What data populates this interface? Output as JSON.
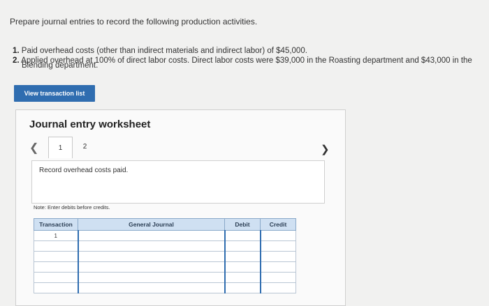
{
  "prompt": "Prepare journal entries to record the following production activities.",
  "requirements": [
    {
      "num": "1.",
      "text": "Paid overhead costs (other than indirect materials and indirect labor) of $45,000."
    },
    {
      "num": "2.",
      "text": "Applied overhead at 100% of direct labor costs. Direct labor costs were $39,000 in the Roasting department and $43,000 in the",
      "cont": "Blending department."
    }
  ],
  "view_button_label": "View transaction list",
  "worksheet": {
    "title": "Journal entry worksheet",
    "prev_icon": "chevron-left-icon",
    "next_icon": "chevron-right-icon",
    "tabs": [
      "1",
      "2"
    ],
    "active_tab": "1",
    "instruction": "Record overhead costs paid.",
    "note": "Note: Enter debits before credits."
  },
  "table": {
    "headers": [
      "Transaction",
      "General Journal",
      "Debit",
      "Credit"
    ],
    "rows": [
      {
        "transaction": "1",
        "account": "",
        "debit": "",
        "credit": ""
      },
      {
        "transaction": "",
        "account": "",
        "debit": "",
        "credit": ""
      },
      {
        "transaction": "",
        "account": "",
        "debit": "",
        "credit": ""
      },
      {
        "transaction": "",
        "account": "",
        "debit": "",
        "credit": ""
      },
      {
        "transaction": "",
        "account": "",
        "debit": "",
        "credit": ""
      },
      {
        "transaction": "",
        "account": "",
        "debit": "",
        "credit": ""
      }
    ]
  },
  "colors": {
    "accent": "#2f6db0",
    "header_bg": "#cfe0f2",
    "page_bg": "#f1f1f0"
  }
}
